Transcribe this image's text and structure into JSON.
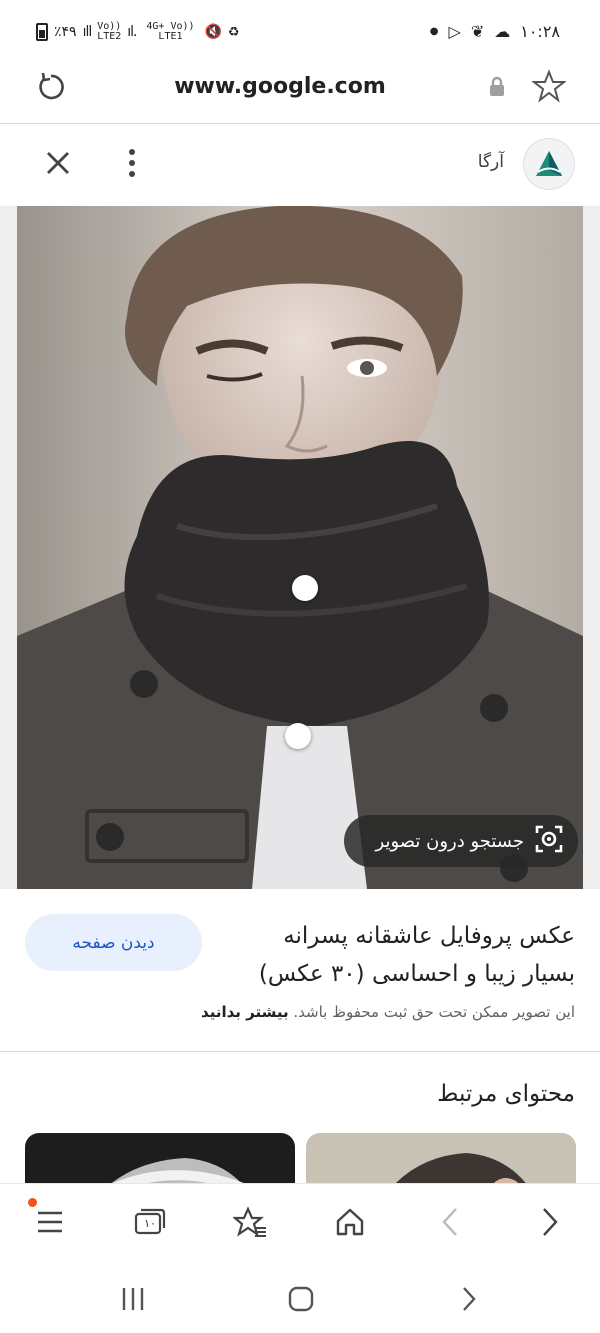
{
  "status_bar": {
    "battery": "٪۴۹",
    "sim1_label": "Vo)) LTE2",
    "sim2_label": "4G+ Vo)) LTE1",
    "time": "۱۰:۲۸"
  },
  "browser": {
    "url": "www.google.com"
  },
  "site": {
    "name": "آرگا"
  },
  "image_viewer": {
    "search_inside_label": "جستجو درون تصویر"
  },
  "result": {
    "visit_label": "دیدن صفحه",
    "title": "عکس پروفایل عاشقانه پسرانه بسیار زیبا و احساسی (۳۰ عکس)",
    "copyright_text": "این تصویر ممکن تحت حق ثبت محفوظ باشد.",
    "learn_more": "بیشتر بدانید"
  },
  "related": {
    "heading": "محتوای مرتبط"
  },
  "toolbar": {
    "tabs_count": "۱۰"
  },
  "colors": {
    "accent_blue": "#1a56c8",
    "visit_bg": "#e8f0fe",
    "notification_dot": "#f4511e"
  }
}
